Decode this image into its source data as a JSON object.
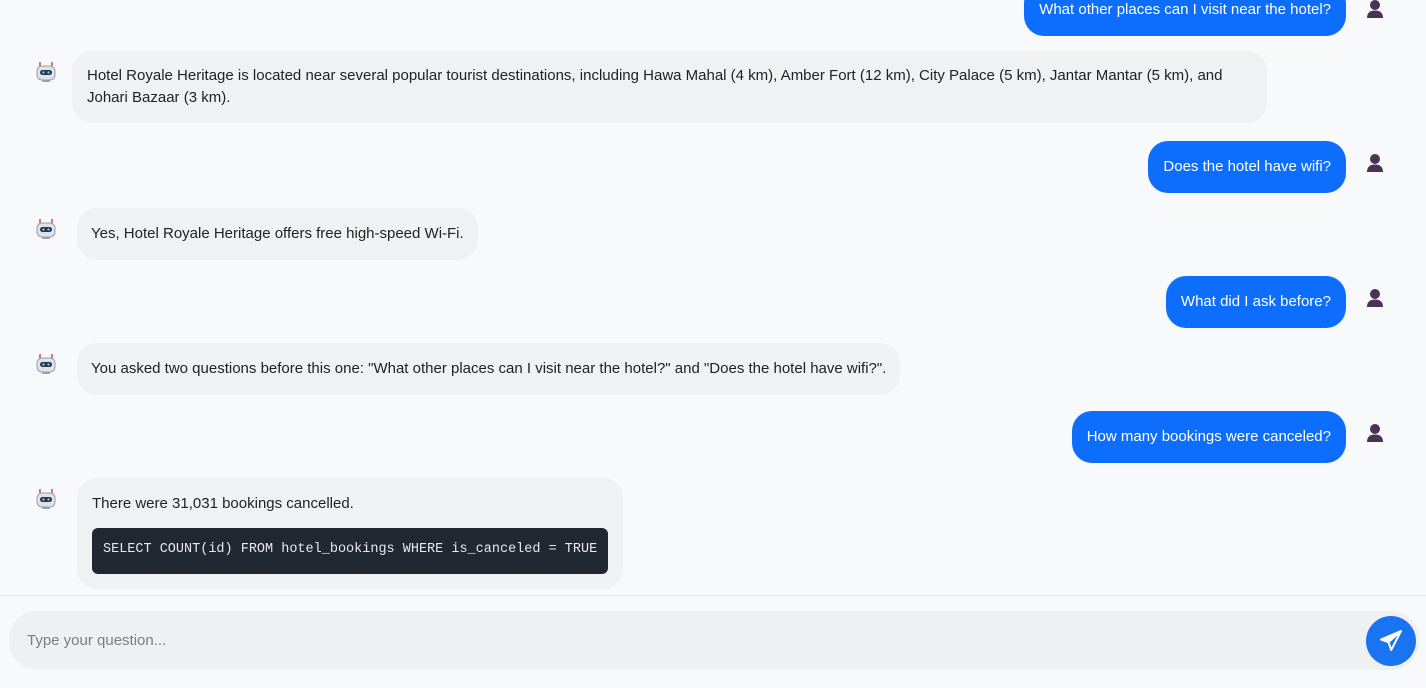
{
  "chat": {
    "messages": [
      {
        "role": "user",
        "text": "What other places can I visit near the hotel?"
      },
      {
        "role": "assistant",
        "text": "Hotel Royale Heritage is located near several popular tourist destinations, including Hawa Mahal (4 km), Amber Fort (12 km), City Palace (5 km), Jantar Mantar (5 km), and Johari Bazaar (3 km)."
      },
      {
        "role": "user",
        "text": "Does the hotel have wifi?"
      },
      {
        "role": "assistant",
        "text": "Yes, Hotel Royale Heritage offers free high-speed Wi-Fi."
      },
      {
        "role": "user",
        "text": "What did I ask before?"
      },
      {
        "role": "assistant",
        "text": "You asked two questions before this one: \"What other places can I visit near the hotel?\" and \"Does the hotel have wifi?\"."
      },
      {
        "role": "user",
        "text": "How many bookings were canceled?"
      },
      {
        "role": "assistant",
        "text": "There were 31,031 bookings cancelled.",
        "code": "SELECT COUNT(id) FROM hotel_bookings WHERE is_canceled = TRUE"
      }
    ]
  },
  "composer": {
    "placeholder": "Type your question...",
    "value": ""
  },
  "icons": {
    "user_avatar": "user-silhouette-icon",
    "bot_avatar": "robot-icon",
    "send": "paper-plane-icon"
  },
  "colors": {
    "user_bubble": "#0d6efd",
    "bot_bubble": "#f0f1f3",
    "code_bg": "#222832",
    "send_button": "#1a73f0",
    "user_avatar": "#4a3354"
  }
}
